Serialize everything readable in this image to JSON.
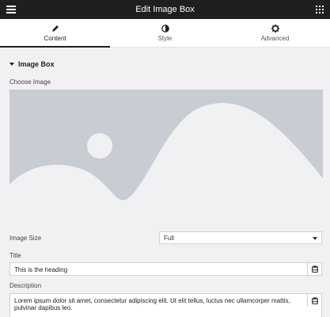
{
  "header": {
    "title": "Edit Image Box"
  },
  "tabs": [
    {
      "label": "Content",
      "icon": "pencil-icon",
      "active": true
    },
    {
      "label": "Style",
      "icon": "contrast-icon",
      "active": false
    },
    {
      "label": "Advanced",
      "icon": "gear-icon",
      "active": false
    }
  ],
  "section": {
    "title": "Image Box"
  },
  "choose_image": {
    "label": "Choose Image"
  },
  "image_size": {
    "label": "Image Size",
    "value": "Full"
  },
  "title_field": {
    "label": "Title",
    "value": "This is the heading"
  },
  "description_field": {
    "label": "Description",
    "value": "Lorem ipsum dolor sit amet, consectetur adipiscing elit. Ut elit tellus, luctus nec ullamcorper mattis, pulvinar dapibus leo."
  },
  "colors": {
    "topbar": "#1f1f21",
    "placeholder_bg": "#c7cdd2",
    "placeholder_fg": "#f1f1f3"
  }
}
